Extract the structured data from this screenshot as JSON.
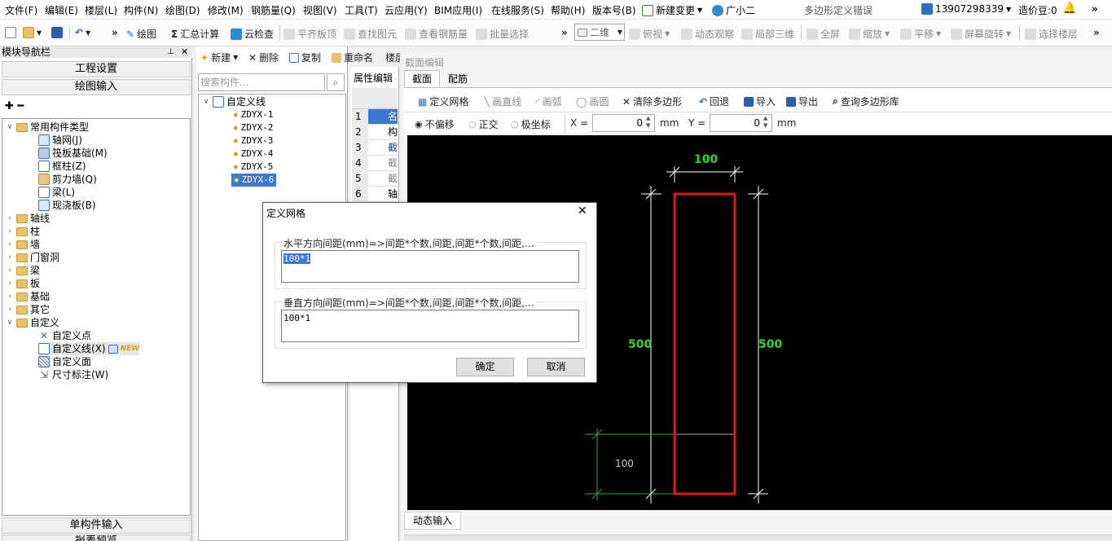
{
  "menubar": {
    "items": [
      "文件(F)",
      "编辑(E)",
      "楼层(L)",
      "构件(N)",
      "绘图(D)",
      "修改(M)",
      "钢筋量(Q)",
      "视图(V)",
      "工具(T)",
      "云应用(Y)",
      "BIM应用(I)",
      "在线服务(S)",
      "帮助(H)",
      "版本号(B)"
    ],
    "new_change": "新建变更",
    "assistant": "广小二",
    "window_title": "多边形定义错误",
    "phone": "13907298339",
    "cost_beans": "造价豆:0"
  },
  "toolbar": {
    "draw": "绘图",
    "sum": "汇总计算",
    "cloud_check": "云检查",
    "flat_top": "平齐板顶",
    "find_elem": "查找图元",
    "view_rebar": "查看钢筋量",
    "batch_select": "批量选择",
    "view_mode": "二维",
    "top_view": "俯视",
    "dynamic": "动态观察",
    "local3d": "局部三维",
    "fullscreen": "全屏",
    "zoom": "缩放",
    "pan": "平移",
    "rotate": "屏幕旋转",
    "select_floor": "选择楼层"
  },
  "nav": {
    "title": "模块导航栏",
    "project_settings": "工程设置",
    "drawing_input": "绘图输入",
    "single_input": "单构件输入",
    "report": "报表预览",
    "tree": {
      "common": "常用构件类型",
      "common_items": [
        "轴网(J)",
        "筏板基础(M)",
        "框柱(Z)",
        "剪力墙(Q)",
        "梁(L)",
        "现浇板(B)"
      ],
      "folders": [
        "轴线",
        "柱",
        "墙",
        "门窗洞",
        "梁",
        "板",
        "基础",
        "其它"
      ],
      "custom": "自定义",
      "custom_items": [
        "自定义点",
        "自定义线(X)",
        "自定义面",
        "尺寸标注(W)"
      ],
      "new_badge": "NEW"
    }
  },
  "components": {
    "new": "新建",
    "delete": "删除",
    "copy": "复制",
    "rename": "重命名",
    "floor": "楼层",
    "search_placeholder": "搜索构件...",
    "root": "自定义线",
    "items": [
      "ZDYX-1",
      "ZDYX-2",
      "ZDYX-3",
      "ZDYX-4",
      "ZDYX-5",
      "ZDYX-6"
    ]
  },
  "props": {
    "title": "属性编辑",
    "rows": [
      {
        "num": "1",
        "name": "名"
      },
      {
        "num": "2",
        "name": "构"
      },
      {
        "num": "3",
        "name": "截"
      },
      {
        "num": "4",
        "name": "截"
      },
      {
        "num": "5",
        "name": "截"
      },
      {
        "num": "6",
        "name": "轴"
      }
    ]
  },
  "section": {
    "title": "截面编辑",
    "tab_section": "截面",
    "tab_rebar": "配筋",
    "define_grid": "定义网格",
    "draw_line": "画直线",
    "draw_arc": "画弧",
    "draw_circle": "画圆",
    "clear_polygon": "清除多边形",
    "undo": "回退",
    "import": "导入",
    "export": "导出",
    "query_lib": "查询多边形库",
    "no_offset": "不偏移",
    "ortho": "正交",
    "polar": "极坐标",
    "x_label": "X =",
    "x_value": "0",
    "y_label": "Y =",
    "y_value": "0",
    "unit": "mm",
    "dim_top": "100",
    "dim_left": "500",
    "dim_right": "500",
    "dim_grid": "100",
    "dynamic_input": "动态输入"
  },
  "dialog": {
    "title": "定义网格",
    "h_label": "水平方向间距(mm)=>间距*个数,间距,间距*个数,间距,...",
    "h_value": "100*1",
    "v_label": "垂直方向间距(mm)=>间距*个数,间距,间距*个数,间距,...",
    "v_value": "100*1",
    "ok": "确定",
    "cancel": "取消"
  },
  "colors": {
    "accent": "#2a6fc9",
    "select_bg": "#3b78d4",
    "dim_green": "#2fd62f",
    "rect_red": "#e0191b"
  }
}
